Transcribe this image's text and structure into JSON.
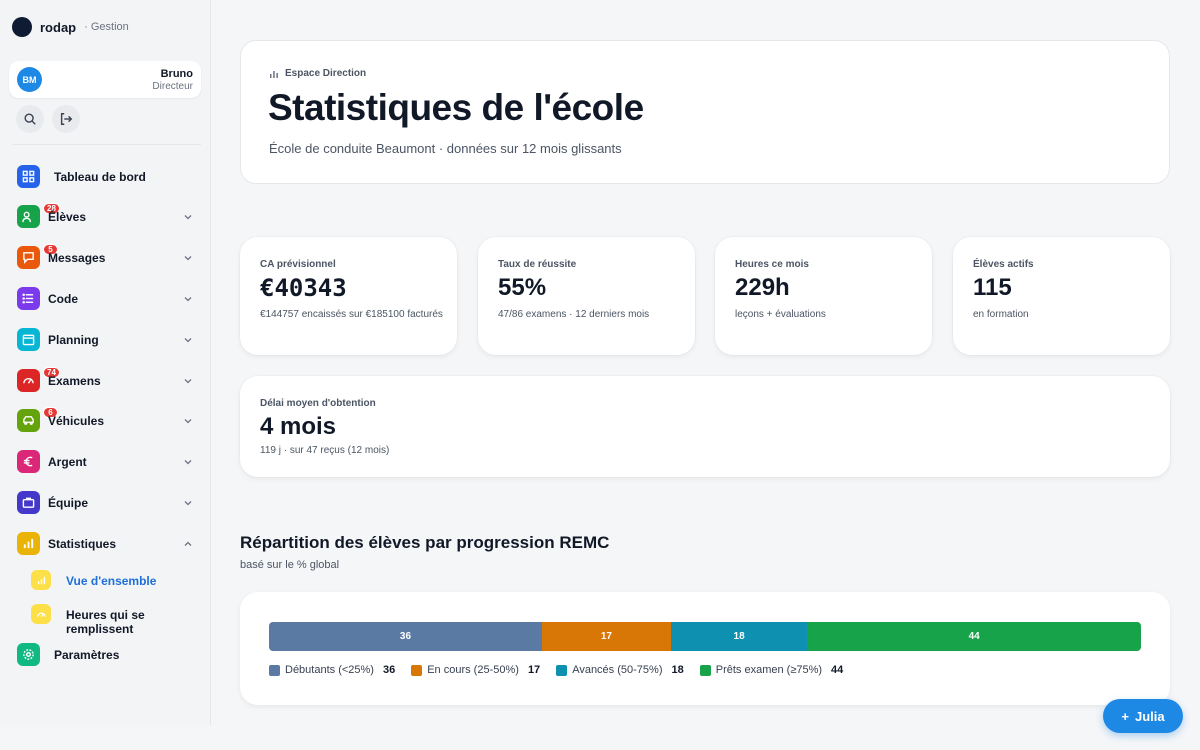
{
  "brand": {
    "name": "rodap",
    "sub": "· Gestion"
  },
  "user": {
    "initials": "BM",
    "name": "Bruno",
    "role": "Directeur"
  },
  "nav": [
    {
      "label": "Tableau de bord",
      "badge": null,
      "color": "#2563eb"
    },
    {
      "label": "Élèves",
      "badge": "28",
      "color": "#16a34a"
    },
    {
      "label": "Messages",
      "badge": "5",
      "color": "#ea580c"
    },
    {
      "label": "Code",
      "badge": null,
      "color": "#7c3aed"
    },
    {
      "label": "Planning",
      "badge": null,
      "color": "#06b6d4"
    },
    {
      "label": "Examens",
      "badge": "74",
      "color": "#dc2626"
    },
    {
      "label": "Véhicules",
      "badge": "6",
      "color": "#65a30d"
    },
    {
      "label": "Argent",
      "badge": null,
      "color": "#db2777"
    },
    {
      "label": "Équipe",
      "badge": null,
      "color": "#4338ca"
    },
    {
      "label": "Statistiques",
      "badge": null,
      "color": "#eab308"
    },
    {
      "label": "Paramètres",
      "badge": null,
      "color": "#10b981"
    }
  ],
  "subnav": [
    {
      "label": "Vue d'ensemble",
      "active": true
    },
    {
      "label": "Heures qui se remplissent",
      "active": false
    }
  ],
  "header": {
    "kicker": "Espace Direction",
    "title": "Statistiques de l'école",
    "subtitle": "École de conduite Beaumont · données sur 12 mois glissants"
  },
  "stats": [
    {
      "label": "CA prévisionnel",
      "value": "€40343",
      "note": "€144757 encaissés sur €185100 facturés"
    },
    {
      "label": "Taux de réussite",
      "value": "55%",
      "note": "47/86 examens · 12 derniers mois"
    },
    {
      "label": "Heures ce mois",
      "value": "229h",
      "note": "leçons + évaluations"
    },
    {
      "label": "Élèves actifs",
      "value": "115",
      "note": "en formation"
    },
    {
      "label": "Délai moyen d'obtention",
      "value": "4 mois",
      "note": "119 j · sur 47 reçus (12 mois)"
    }
  ],
  "distribution": {
    "title": "Répartition des élèves par progression REMC",
    "subtitle": "basé sur le % global",
    "segments": [
      {
        "label": "Débutants (<25%)",
        "value": 36,
        "color": "#5b7aa3"
      },
      {
        "label": "En cours (25-50%)",
        "value": 17,
        "color": "#d97706"
      },
      {
        "label": "Avancés (50-75%)",
        "value": 18,
        "color": "#0e91b0"
      },
      {
        "label": "Prêts examen (≥75%)",
        "value": 44,
        "color": "#16a34a"
      }
    ]
  },
  "fab": {
    "label": "Julia"
  }
}
